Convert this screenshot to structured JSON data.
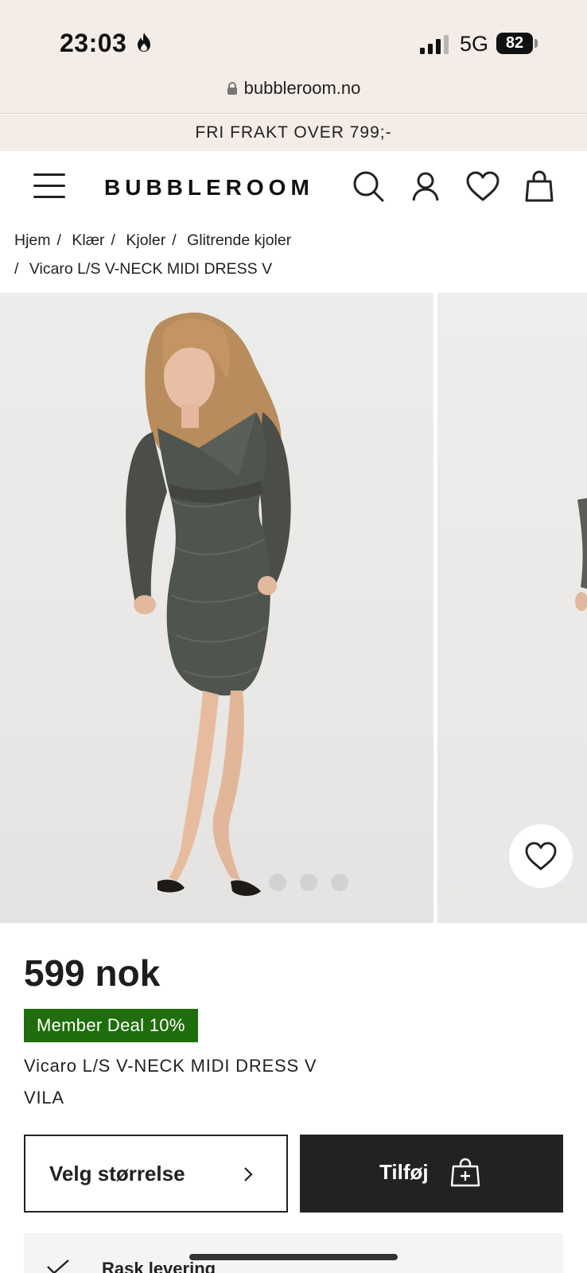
{
  "status_bar": {
    "time": "23:03",
    "network": "5G",
    "battery": "82"
  },
  "browser": {
    "url": "bubbleroom.no"
  },
  "promo": {
    "text": "FRI FRAKT OVER 799;-"
  },
  "header": {
    "logo": "BUBBLEROOM",
    "icons": [
      "menu-icon",
      "search-icon",
      "account-icon",
      "heart-icon",
      "bag-icon"
    ]
  },
  "breadcrumb": {
    "items": [
      "Hjem",
      "Klær",
      "Kjoler",
      "Glitrende kjoler",
      "Vicaro L/S V-NECK MIDI DRESS V"
    ]
  },
  "gallery": {
    "dots": 3
  },
  "product": {
    "price": "599 nok",
    "badge": "Member Deal 10%",
    "name": "Vicaro L/S V-NECK MIDI DRESS V",
    "brand": "VILA"
  },
  "actions": {
    "size_label": "Velg størrelse",
    "add_label": "Tilføj"
  },
  "delivery": {
    "label": "Rask levering"
  },
  "colors": {
    "badge": "#1f6d0c",
    "chrome": "#f4ece6",
    "dark_button": "#222222"
  }
}
